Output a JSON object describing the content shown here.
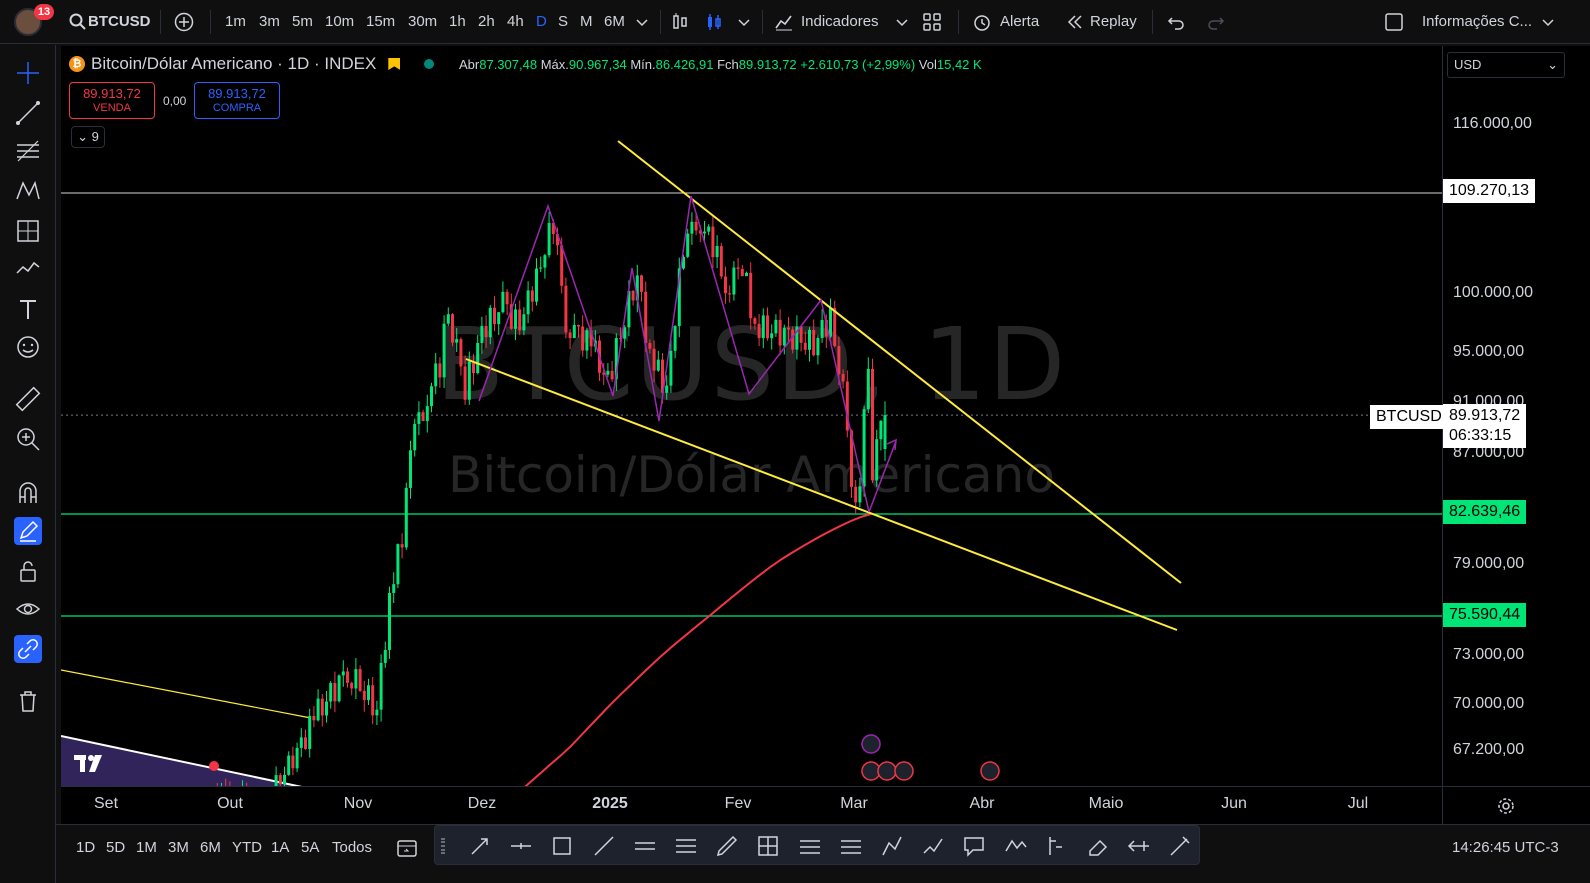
{
  "topbar": {
    "notification_count": "13",
    "symbol": "BTCUSD",
    "intervals": [
      "1m",
      "3m",
      "5m",
      "10m",
      "15m",
      "30m",
      "1h",
      "2h",
      "4h",
      "D",
      "S",
      "M",
      "6M"
    ],
    "active_interval": "D",
    "indicators_label": "Indicadores",
    "alert_label": "Alerta",
    "replay_label": "Replay",
    "info_label": "Informações C..."
  },
  "legend": {
    "title": "Bitcoin/Dólar Americano · 1D · INDEX",
    "btc_glyph": "₿",
    "open_label": "Abr",
    "open": "87.307,48",
    "high_label": "Máx.",
    "high": "90.967,34",
    "low_label": "Mín.",
    "low": "86.426,91",
    "close_label": "Fch",
    "close": "89.913,72",
    "change": "+2.610,73 (+2,99%)",
    "vol_label": "Vol",
    "vol": "15,42 K",
    "sell_price": "89.913,72",
    "sell_label": "VENDA",
    "spread": "0,00",
    "buy_price": "89.913,72",
    "buy_label": "COMPRA",
    "indicator_count": "9"
  },
  "watermark": {
    "symbol_tf": "BTCUSD, 1D",
    "name": "Bitcoin/Dólar Americano"
  },
  "price_scale": {
    "currency": "USD",
    "ticks": [
      "116.000,00",
      "100.000,00",
      "95.000,00",
      "91.000,00",
      "87.000,00",
      "79.000,00",
      "73.000,00",
      "70.000,00",
      "67.200,00"
    ],
    "badges": {
      "resistance": "109.270,13",
      "last_price": "89.913,72",
      "countdown": "06:33:15",
      "symbol": "BTCUSD",
      "support1": "82.639,46",
      "support2": "75.590,44"
    }
  },
  "time_scale": {
    "ticks": [
      "Set",
      "Out",
      "Nov",
      "Dez",
      "2025",
      "Fev",
      "Mar",
      "Abr",
      "Maio",
      "Jun",
      "Jul"
    ]
  },
  "bottombar": {
    "ranges": [
      "1D",
      "5D",
      "1M",
      "3M",
      "6M",
      "YTD",
      "1A",
      "5A",
      "Todos"
    ],
    "clock": "14:26:45 UTC-3"
  },
  "colors": {
    "up": "#00e676",
    "down": "#f23645",
    "trend": "#ffeb3b",
    "ma": "#f23645",
    "hline": "#00e676",
    "pattern": "#9c27b0",
    "accent": "#2962ff"
  },
  "chart_data": {
    "type": "candlestick",
    "title": "Bitcoin/Dólar Americano · 1D · INDEX",
    "x_axis": [
      "Set",
      "Out",
      "Nov",
      "Dez",
      "2025",
      "Fev",
      "Mar",
      "Abr",
      "Maio",
      "Jun",
      "Jul"
    ],
    "y_axis_ticks": [
      116000,
      100000,
      95000,
      91000,
      87000,
      79000,
      73000,
      70000,
      67200
    ],
    "last": {
      "open": 87307.48,
      "high": 90967.34,
      "low": 86426.91,
      "close": 89913.72
    },
    "horizontal_lines": [
      109270.13,
      89913.72,
      82639.46,
      75590.44
    ],
    "candles_close_series": [
      [
        "2024-09-25",
        63000
      ],
      [
        "2024-10-01",
        64500
      ],
      [
        "2024-10-08",
        62500
      ],
      [
        "2024-10-15",
        66000
      ],
      [
        "2024-10-21",
        69000
      ],
      [
        "2024-10-29",
        72000
      ],
      [
        "2024-11-05",
        69500
      ],
      [
        "2024-11-08",
        76500
      ],
      [
        "2024-11-11",
        81000
      ],
      [
        "2024-11-13",
        88000
      ],
      [
        "2024-11-16",
        90500
      ],
      [
        "2024-11-20",
        94000
      ],
      [
        "2024-11-22",
        98500
      ],
      [
        "2024-11-26",
        92000
      ],
      [
        "2024-11-30",
        96500
      ],
      [
        "2024-12-05",
        99000
      ],
      [
        "2024-12-09",
        97000
      ],
      [
        "2024-12-13",
        101500
      ],
      [
        "2024-12-17",
        106500
      ],
      [
        "2024-12-20",
        97500
      ],
      [
        "2024-12-26",
        95500
      ],
      [
        "2024-12-30",
        92500
      ],
      [
        "2025-01-06",
        101500
      ],
      [
        "2025-01-09",
        94500
      ],
      [
        "2025-01-13",
        92000
      ],
      [
        "2025-01-17",
        104000
      ],
      [
        "2025-01-20",
        107000
      ],
      [
        "2025-01-24",
        104500
      ],
      [
        "2025-01-27",
        100500
      ],
      [
        "2025-01-31",
        102500
      ],
      [
        "2025-02-03",
        97000
      ],
      [
        "2025-02-10",
        96500
      ],
      [
        "2025-02-17",
        95500
      ],
      [
        "2025-02-21",
        98000
      ],
      [
        "2025-02-24",
        91500
      ],
      [
        "2025-02-26",
        84500
      ],
      [
        "2025-02-28",
        84300
      ],
      [
        "2025-03-02",
        94300
      ],
      [
        "2025-03-03",
        86000
      ],
      [
        "2025-03-04",
        87300
      ],
      [
        "2025-03-05",
        89913
      ]
    ],
    "moving_average_end": 82639
  }
}
